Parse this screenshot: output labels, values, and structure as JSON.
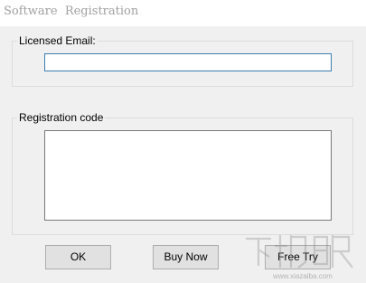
{
  "window": {
    "title": "Software  Registration"
  },
  "email_group": {
    "legend": "Licensed Email:",
    "email_value": ""
  },
  "code_group": {
    "legend": "Registration code",
    "code_value": ""
  },
  "buttons": {
    "ok": "OK",
    "buy_now": "Buy Now",
    "free_try": "Free Try"
  },
  "watermark": {
    "text": "下载吧",
    "url": "www.xiazaiba.com"
  },
  "colors": {
    "background": "#f0f0f0",
    "titlebar": "#ffffff",
    "title_text": "#a0a0a0",
    "input_focus_border": "#3c7fb1",
    "button_face": "#e1e1e1",
    "button_border": "#adadad"
  }
}
